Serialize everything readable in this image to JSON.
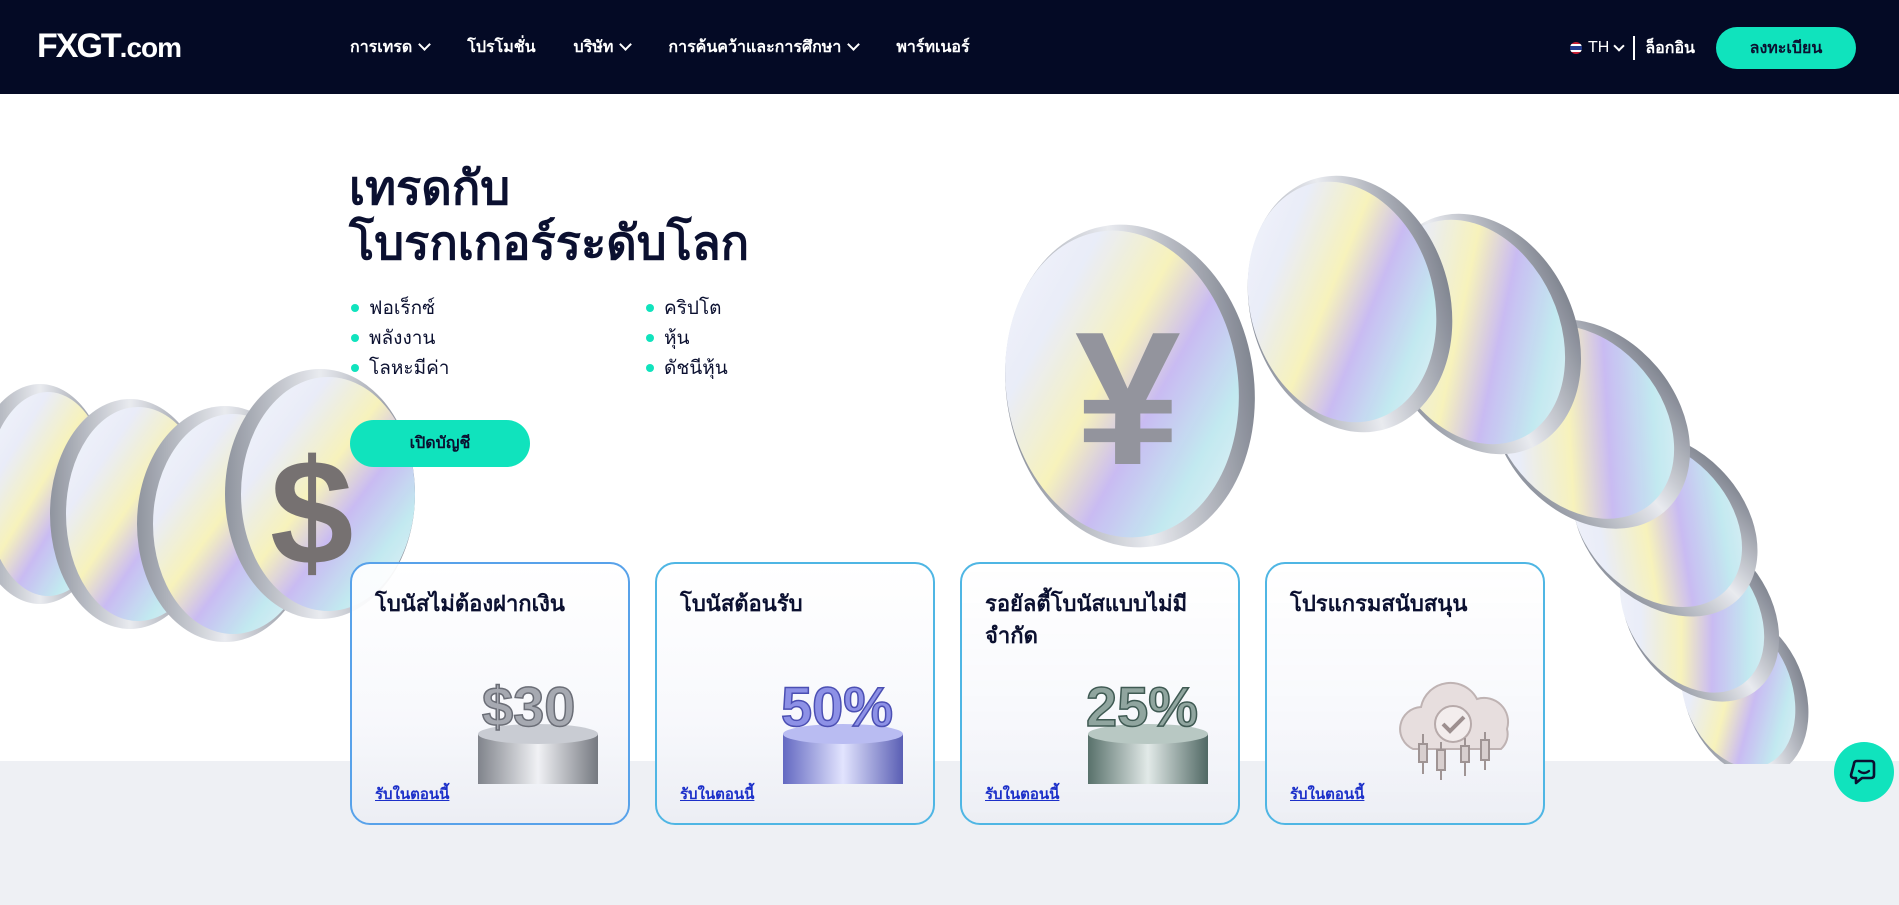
{
  "header": {
    "logo_text": "FXGT",
    "logo_tld": ".com",
    "nav": [
      {
        "label": "การเทรด",
        "has_dropdown": true
      },
      {
        "label": "โปรโมชั่น",
        "has_dropdown": false
      },
      {
        "label": "บริษัท",
        "has_dropdown": true
      },
      {
        "label": "การค้นคว้าและการศึกษา",
        "has_dropdown": true
      },
      {
        "label": "พาร์ทเนอร์",
        "has_dropdown": false
      }
    ],
    "language": "TH",
    "login_label": "ล็อกอิน",
    "register_label": "ลงทะเบียน"
  },
  "hero": {
    "title_line1": "เทรดกับ",
    "title_line2": "โบรกเกอร์ระดับโลก",
    "assets": [
      "ฟอเร็กซ์",
      "คริปโต",
      "พลังงาน",
      "หุ้น",
      "โลหะมีค่า",
      "ดัชนีหุ้น"
    ],
    "cta_label": "เปิดบัญชี"
  },
  "promos": [
    {
      "title": "โบนัสไม่ต้องฝากเงิน",
      "art": "$30",
      "link": "รับในตอนนี้"
    },
    {
      "title": "โบนัสต้อนรับ",
      "art": "50%",
      "link": "รับในตอนนี้"
    },
    {
      "title": "รอยัลตี้โบนัสแบบไม่มีจำกัด",
      "art": "25%",
      "link": "รับในตอนนี้"
    },
    {
      "title": "โปรแกรมสนับสนุน",
      "art": "cloud-chart-icon",
      "link": "รับในตอนนี้"
    }
  ],
  "colors": {
    "header_bg": "#040a25",
    "accent": "#10e3bd",
    "text_dark": "#0b1030",
    "link": "#1c30c9"
  }
}
